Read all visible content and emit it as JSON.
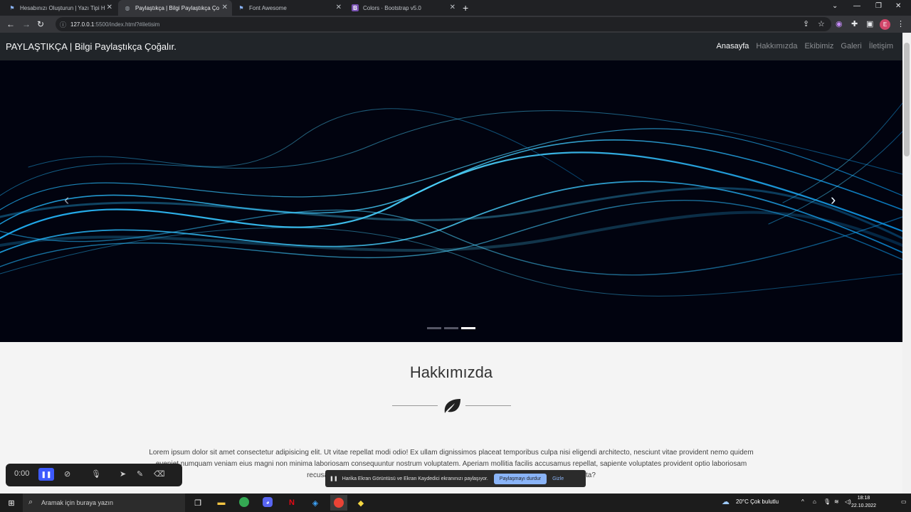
{
  "browser": {
    "tabs": [
      {
        "title": "Hesabınızı Oluşturun | Yazı Tipi H",
        "icon": "flag-icon",
        "active": false
      },
      {
        "title": "Paylaştıkça | Bilgi Paylaştıkça Ço",
        "icon": "globe-icon",
        "active": true
      },
      {
        "title": "Font Awesome",
        "icon": "flag-icon",
        "active": false
      },
      {
        "title": "Colors · Bootstrap v5.0",
        "icon": "bootstrap-icon",
        "active": false
      }
    ],
    "url_host": "127.0.0.1",
    "url_path": ":5500/index.html?#iletisim",
    "profile_initial": "E"
  },
  "site": {
    "brand": "PAYLAŞTIKÇA | Bilgi Paylaştıkça Çoğalır.",
    "menu": [
      {
        "label": "Anasayfa",
        "active": true
      },
      {
        "label": "Hakkımızda",
        "active": false
      },
      {
        "label": "Ekibimiz",
        "active": false
      },
      {
        "label": "Galeri",
        "active": false
      },
      {
        "label": "İletişim",
        "active": false
      }
    ],
    "carousel": {
      "slide_count": 3,
      "active_index": 2
    },
    "about": {
      "title": "Hakkımızda",
      "icon": "leaf-icon",
      "text": "Lorem ipsum dolor sit amet consectetur adipisicing elit. Ut vitae repellat modi odio! Ex ullam dignissimos placeat temporibus culpa nisi eligendi architecto, nesciunt vitae provident nemo quidem eveniet numquam veniam eius magni non minima laboriosam consequuntur nostrum voluptatem. Aperiam mollitia facilis accusamus repellat, sapiente voluptates provident optio laboriosam recusandae amet. Voluptatibus similique velit totam quidem ex nesciunt voluptate expedita?"
    }
  },
  "recorder": {
    "time": "0:00"
  },
  "share_bar": {
    "message": "Harika Ekran Görüntüsü ve Ekran Kaydedici ekranınızı paylaşıyor.",
    "stop_label": "Paylaşmayı durdur",
    "hide_label": "Gizle"
  },
  "taskbar": {
    "search_placeholder": "Aramak için buraya yazın",
    "weather": "20°C  Çok bulutlu",
    "time": "18:18",
    "date": "22.10.2022"
  }
}
